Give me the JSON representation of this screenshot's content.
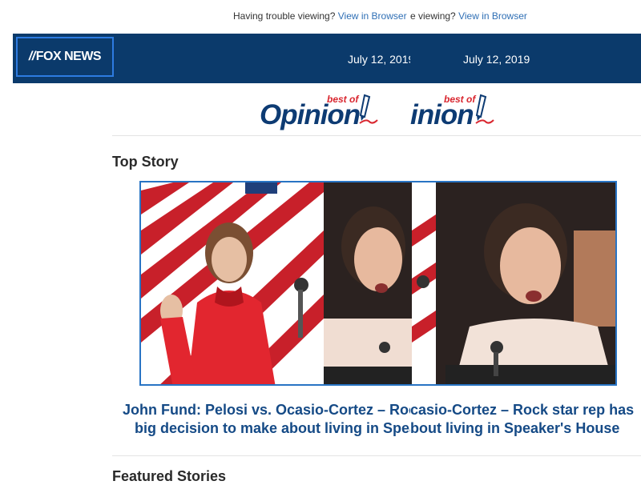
{
  "trouble_bar": {
    "text": "Having trouble viewing?",
    "text_repeat": "viewing?",
    "link": "View in Browser"
  },
  "header": {
    "logo_text": "FOX NEWS",
    "date": "July 12, 2019"
  },
  "brand": {
    "best_of": "best of",
    "opinion": "Opinion",
    "opinion_cropped": "inion"
  },
  "top_story": {
    "section_title": "Top Story",
    "headline_line1": "John Fund: Pelosi vs. Ocasio-Cortez – Rock star rep has",
    "headline_line2": "big decision to make about living in Speaker's House",
    "headline_right_line1": "casio-Cortez – Rock star rep has",
    "headline_right_line2": "bout living in Speaker's House"
  },
  "featured": {
    "section_title": "Featured Stories"
  },
  "colors": {
    "header_bg": "#0b3a6b",
    "headline": "#154a86",
    "link": "#2f6fb5",
    "accent_red": "#d9262f"
  },
  "icons": [
    "pen-icon"
  ]
}
